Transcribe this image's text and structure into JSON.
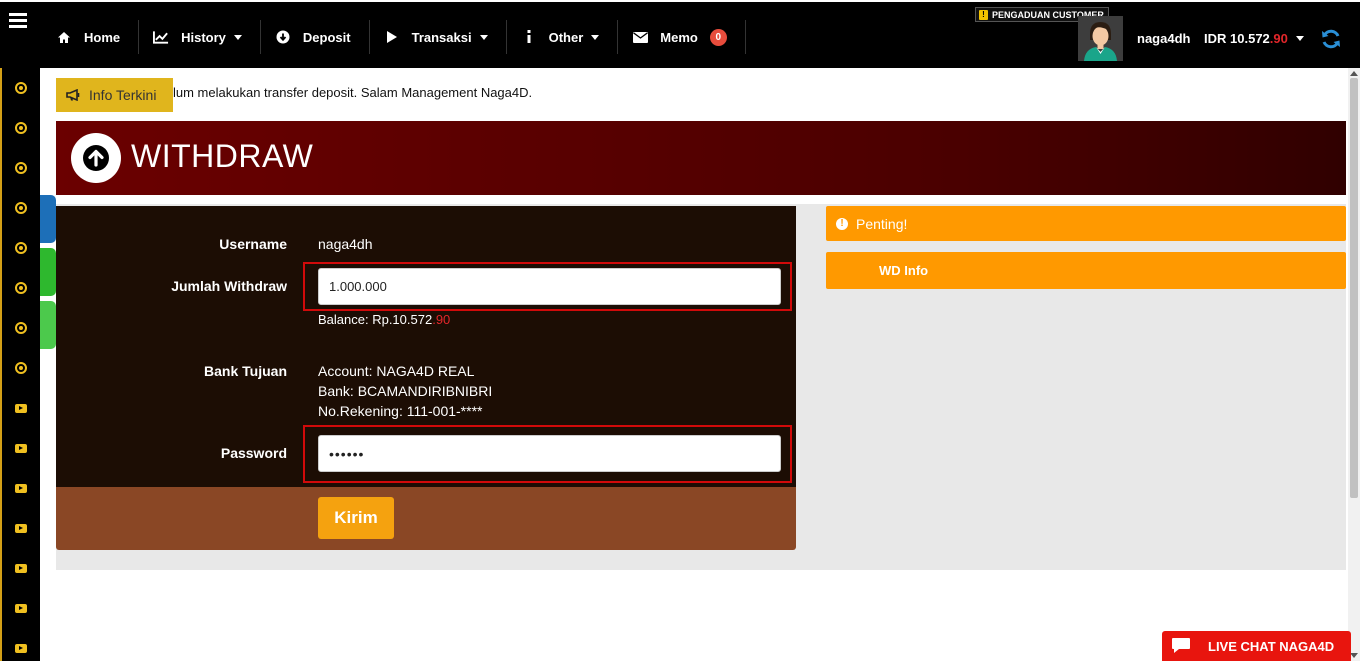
{
  "nav": {
    "items": [
      {
        "label": "Home",
        "icon": "home-icon"
      },
      {
        "label": "History",
        "icon": "chart-line-icon",
        "dropdown": true
      },
      {
        "label": "Deposit",
        "icon": "arrow-down-circle-icon"
      },
      {
        "label": "Transaksi",
        "icon": "play-icon",
        "dropdown": true
      },
      {
        "label": "Other",
        "icon": "info-icon",
        "dropdown": true
      },
      {
        "label": "Memo",
        "icon": "envelope-icon",
        "badge": "0"
      }
    ]
  },
  "header": {
    "complaint_label": "PENGADUAN CUSTOMER",
    "username": "naga4dh",
    "currency": "IDR",
    "balance_main": "10.572",
    "balance_decimal": ".90"
  },
  "marquee": {
    "button_label": "Info Terkini",
    "text": "lum melakukan transfer deposit. Salam Management Naga4D."
  },
  "page": {
    "title": "WITHDRAW"
  },
  "form": {
    "username_label": "Username",
    "username_value": "naga4dh",
    "amount_label": "Jumlah Withdraw",
    "amount_value": "1.000.000",
    "balance_prefix": "Balance: Rp.10.572",
    "balance_decimal": ".90",
    "bank_label": "Bank Tujuan",
    "account_line": "Account: NAGA4D REAL",
    "bank_line": "Bank: BCAMANDIRIBNIBRI",
    "rekening_line": "No.Rekening: 111-001-****",
    "password_label": "Password",
    "password_value": "••••••",
    "submit_label": "Kirim"
  },
  "side": {
    "penting_label": "Penting!",
    "wdinfo_label": "WD Info"
  },
  "livechat": {
    "label": "LIVE CHAT NAGA4D"
  },
  "colors": {
    "accent_orange": "#ff9900",
    "banner_red": "#6b0000",
    "highlight_red": "#d10a0a",
    "gold": "#e0b51d"
  }
}
